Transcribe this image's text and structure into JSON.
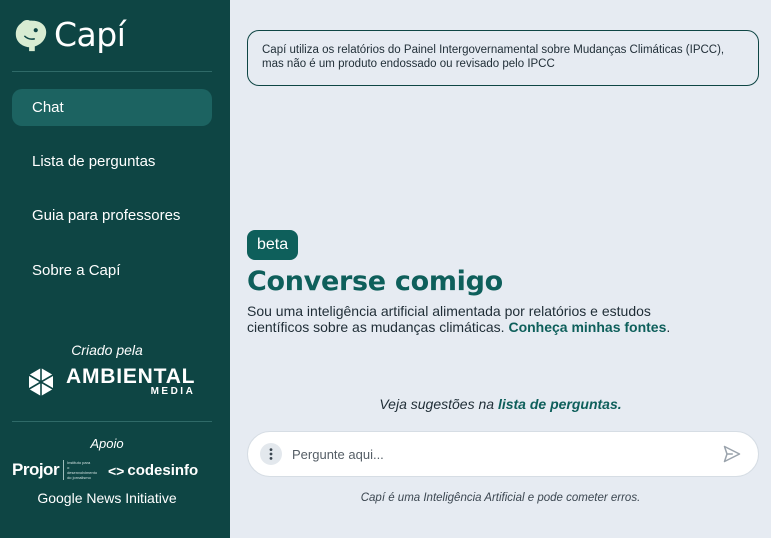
{
  "brand": {
    "name": "Capí"
  },
  "nav": [
    {
      "label": "Chat",
      "active": true
    },
    {
      "label": "Lista de perguntas",
      "active": false
    },
    {
      "label": "Guia para professores",
      "active": false
    },
    {
      "label": "Sobre a Capí",
      "active": false
    }
  ],
  "credits": {
    "created_by": "Criado pela",
    "ambiental_big": "AMBIENTAL",
    "ambiental_small": "MEDIA",
    "support": "Apoio",
    "projor": "Projor",
    "projor_tag": "Instituto para o desenvolvimento do jornalismo",
    "codesinfo": "codesinfo",
    "google_news": "Google News Initiative"
  },
  "notice": "Capí utiliza os relatórios do Painel Intergovernamental sobre Mudanças Climáticas (IPCC), mas não é um produto endossado ou revisado pelo IPCC",
  "hero": {
    "badge": "beta",
    "title": "Converse comigo",
    "description": "Sou uma inteligência artificial alimentada por relatórios e estudos científicos sobre as mudanças climáticas.",
    "sources_link": "Conheça minhas fontes",
    "sources_suffix": "."
  },
  "suggestions": {
    "prefix": "Veja sugestões na",
    "link": "lista de perguntas."
  },
  "input": {
    "placeholder": "Pergunte aqui...",
    "value": ""
  },
  "disclaimer": "Capí é uma Inteligência Artificial e pode cometer erros.",
  "colors": {
    "sidebar": "#0e4544",
    "accent": "#0e5f5b",
    "background": "#e6ebf2"
  },
  "icons": {
    "brand": "capybara-icon",
    "ambiental": "polygon-logo-icon",
    "menu": "more-vertical-icon",
    "send": "send-icon"
  }
}
